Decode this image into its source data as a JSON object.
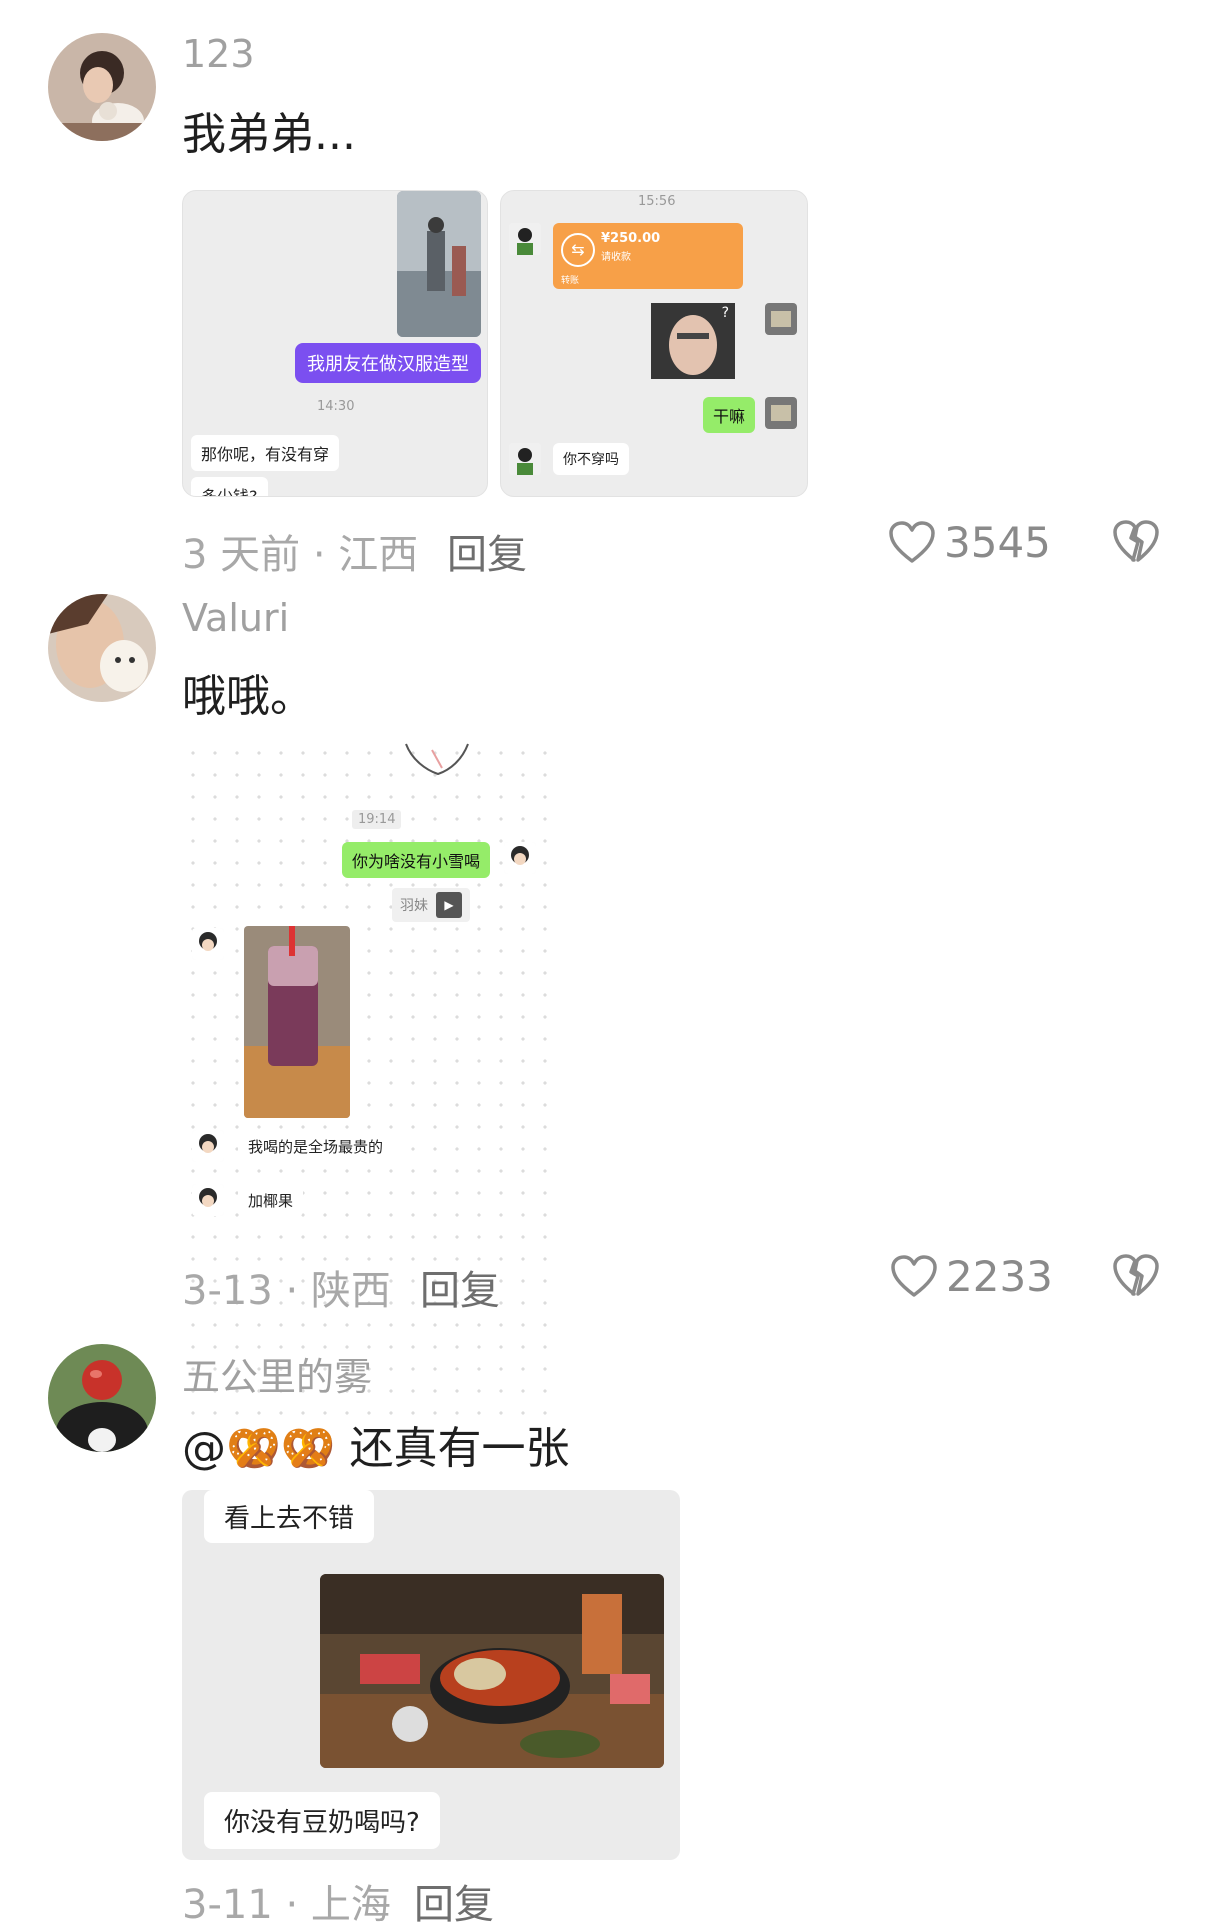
{
  "comments": [
    {
      "username": "123",
      "text": "我弟弟...",
      "time_location": "3 天前 · 江西",
      "reply_label": "回复",
      "likes": "3545",
      "screenshot1": {
        "purple_msg": "我朋友在做汉服造型",
        "time": "14:30",
        "msg1": "那你呢，有没有穿",
        "msg2": "多少钱?"
      },
      "screenshot2": {
        "time": "15:56",
        "transfer_amount": "¥250.00",
        "transfer_sub": "请收款",
        "transfer_foot": "转账",
        "q_mark": "?",
        "green_msg": "干嘛",
        "msg": "你不穿吗"
      }
    },
    {
      "username": "Valuri",
      "text": "哦哦。",
      "time_location": "3-13 · 陕西",
      "reply_label": "回复",
      "likes": "2233",
      "screenshot": {
        "time": "19:14",
        "green_msg": "你为啥没有小雪喝",
        "tag": "羽妹",
        "msg1": "我喝的是全场最贵的",
        "msg2": "加椰果"
      }
    },
    {
      "username": "五公里的雾",
      "text": "@🥨🥨 还真有一张",
      "time_location": "3-11 · 上海",
      "reply_label": "回复",
      "screenshot": {
        "msg1": "看上去不错",
        "msg2": "你没有豆奶喝吗?"
      }
    }
  ],
  "colors": {
    "username": "#a0a0a0",
    "meta": "#a8a8a8",
    "wechat_green": "#95ec69",
    "purple": "#7b4ff0",
    "orange": "#f7a048"
  },
  "icons": [
    "heart-icon",
    "broken-heart-icon"
  ]
}
